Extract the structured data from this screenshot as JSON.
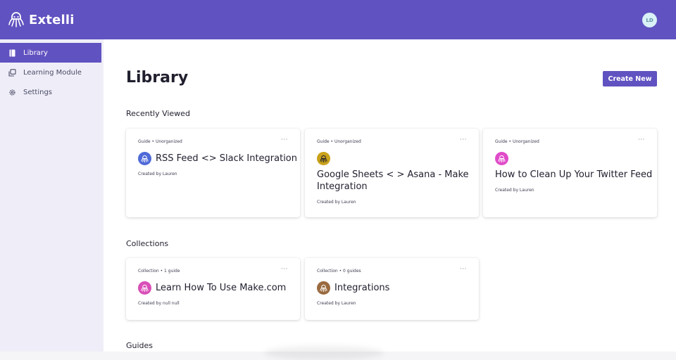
{
  "app": {
    "brand": "Extelli",
    "avatar_initials": "LD",
    "accent_color": "#6052c0"
  },
  "sidebar": {
    "items": [
      {
        "label": "Library",
        "icon": "book-icon",
        "active": true
      },
      {
        "label": "Learning Module",
        "icon": "stacked-pages-icon",
        "active": false
      },
      {
        "label": "Settings",
        "icon": "gear-icon",
        "active": false
      }
    ]
  },
  "main": {
    "title": "Library",
    "create_label": "Create New",
    "sections": {
      "recent": "Recently Viewed",
      "collections": "Collections",
      "guides": "Guides"
    }
  },
  "recent": [
    {
      "meta": "Guide • Unorganized",
      "title": "RSS Feed <> Slack Integration",
      "author": "Created by Lauren",
      "icon_color": "#4f6ad8",
      "icon": "extelli-mark-icon"
    },
    {
      "meta": "Guide • Unorganized",
      "title_line1": "Google Sheets < > Asana - Make",
      "title_line2": "Integration",
      "author": "Created by Lauren",
      "icon_color": "#c9a21a",
      "icon": "extelli-mark-icon"
    },
    {
      "meta": "Guide • Unorganized",
      "title": "How to Clean Up Your Twitter Feed",
      "author": "Created by Lauren",
      "icon_color": "#e04bc9",
      "icon": "extelli-mark-icon"
    }
  ],
  "collections": [
    {
      "meta": "Collection • 1 guide",
      "title": "Learn How To Use Make.com",
      "author": "Created by null null",
      "icon_color": "#d94fb8",
      "icon": "extelli-mark-icon"
    },
    {
      "meta": "Collection • 0 guides",
      "title": "Integrations",
      "author": "Created by Lauren",
      "icon_color": "#9a6a3f",
      "icon": "extelli-mark-icon"
    }
  ]
}
